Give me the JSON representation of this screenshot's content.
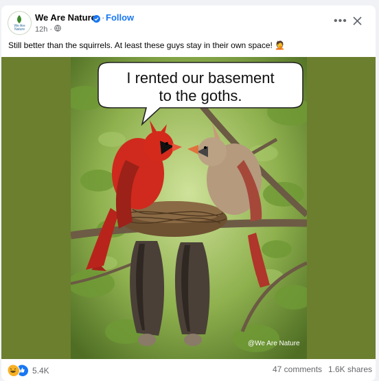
{
  "post": {
    "page_name": "We Are Nature",
    "avatar_text": [
      "We Are",
      "Nature"
    ],
    "follow_label": "Follow",
    "separator": "·",
    "time": "12h",
    "audience_icon": "globe-icon",
    "more_icon": "more-options-icon",
    "close_icon": "close-icon",
    "caption": "Still better than the squirrels. At least these guys stay in their own space! 🤦"
  },
  "image": {
    "speech_bubble_lines": [
      "I rented our basement",
      "to the goths."
    ],
    "watermark": "@We Are Nature"
  },
  "footer": {
    "reaction_icons": [
      "haha-icon",
      "like-icon"
    ],
    "reaction_count": "5.4K",
    "comments": "47 comments",
    "shares": "1.6K shares"
  },
  "colors": {
    "accent": "#1877f2",
    "muted_text": "#65676b",
    "photo_padding": "#6b7f2e",
    "cardinal_male": "#d42a1c",
    "cardinal_female": "#b59a7e"
  }
}
